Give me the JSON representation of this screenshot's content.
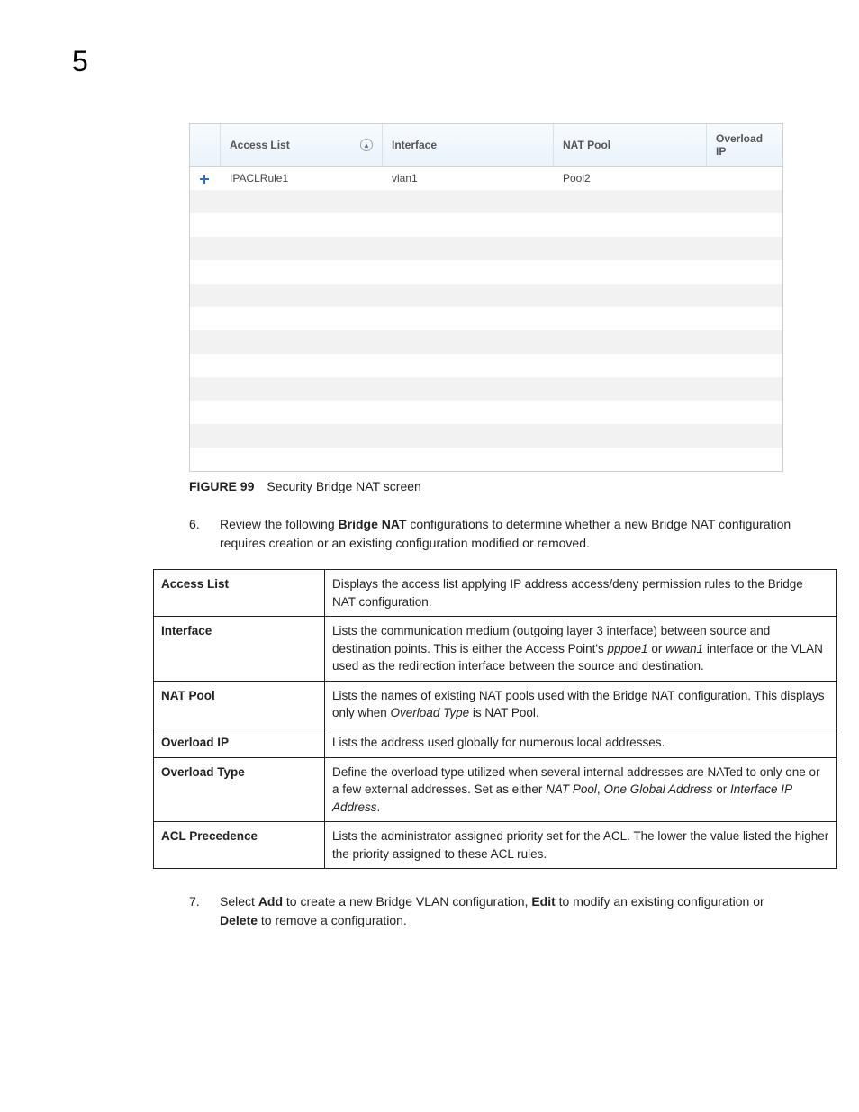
{
  "pageNumber": "5",
  "screenshot": {
    "headers": [
      "Access List",
      "Interface",
      "NAT Pool",
      "Overload IP"
    ],
    "rows": [
      {
        "accessList": "IPACLRule1",
        "interface": "vlan1",
        "natPool": "Pool2",
        "overloadIp": ""
      }
    ],
    "sortedColumn": 0
  },
  "figure": {
    "label": "FIGURE 99",
    "caption": "Security Bridge NAT screen"
  },
  "step6": {
    "num": "6.",
    "pre": "Review the following ",
    "bold": "Bridge NAT",
    "post": " configurations to determine whether a new Bridge NAT configuration requires creation or an existing configuration modified or removed."
  },
  "defs": [
    {
      "term": "Access List",
      "desc_html": "Displays the access list applying IP address access/deny permission rules to the Bridge NAT configuration."
    },
    {
      "term": "Interface",
      "desc_html": "Lists the communication medium (outgoing layer 3 interface) between source and destination points. This is either the Access Point's <em>pppoe1</em> or <em>wwan1</em> interface or the VLAN used as the redirection interface between the source and destination."
    },
    {
      "term": "NAT Pool",
      "desc_html": "Lists the names of existing NAT pools used with the Bridge NAT configuration. This displays only when <em>Overload Type</em> is NAT Pool."
    },
    {
      "term": "Overload IP",
      "desc_html": "Lists the address used globally for numerous local addresses."
    },
    {
      "term": "Overload Type",
      "desc_html": "Define the overload type utilized when several internal addresses are NATed to only one or a few external addresses. Set as either <em>NAT Pool</em>, <em>One Global Address</em> or <em>Interface IP Address</em>."
    },
    {
      "term": "ACL Precedence",
      "desc_html": "Lists the administrator assigned priority set for the ACL. The lower the value listed the higher the priority assigned to these ACL rules."
    }
  ],
  "step7": {
    "num": "7.",
    "parts": [
      {
        "t": "Select "
      },
      {
        "b": "Add"
      },
      {
        "t": " to create a new Bridge VLAN configuration, "
      },
      {
        "b": "Edit"
      },
      {
        "t": " to modify an existing configuration or "
      },
      {
        "b": "Delete"
      },
      {
        "t": " to remove a configuration."
      }
    ]
  }
}
